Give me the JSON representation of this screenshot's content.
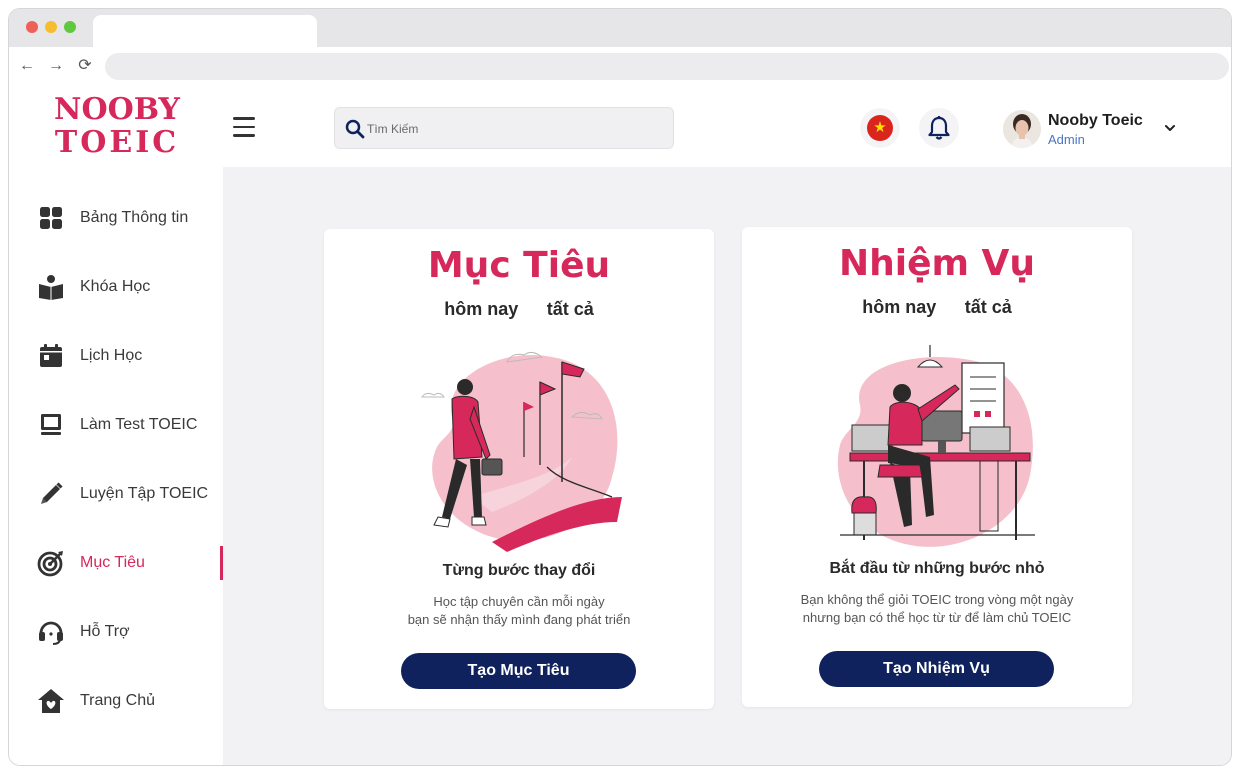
{
  "logo": {
    "line1": "NOOBY",
    "line2": "TOEIC"
  },
  "search": {
    "placeholder": "Tìm Kiếm"
  },
  "user": {
    "name": "Nooby Toeic",
    "role": "Admin"
  },
  "sidebar": {
    "items": [
      {
        "label": "Bảng Thông tin",
        "icon": "dashboard-icon"
      },
      {
        "label": "Khóa Học",
        "icon": "course-icon"
      },
      {
        "label": "Lịch Học",
        "icon": "calendar-icon"
      },
      {
        "label": "Làm Test TOEIC",
        "icon": "computer-icon"
      },
      {
        "label": "Luyện Tập TOEIC",
        "icon": "pencil-icon"
      },
      {
        "label": "Mục Tiêu",
        "icon": "target-icon",
        "active": true
      },
      {
        "label": "Hỗ Trợ",
        "icon": "headset-icon"
      },
      {
        "label": "Trang Chủ",
        "icon": "home-icon"
      }
    ]
  },
  "cards": [
    {
      "title": "Mục Tiêu",
      "filters": [
        "hôm nay",
        "tất cả"
      ],
      "subtitle": "Từng bước thay đổi",
      "desc_line1": "Học tập chuyên cần mỗi ngày",
      "desc_line2": "bạn sẽ nhận thấy mình đang phát triển",
      "button": "Tạo Mục Tiêu"
    },
    {
      "title": "Nhiệm Vụ",
      "filters": [
        "hôm nay",
        "tất cả"
      ],
      "subtitle": "Bắt đầu từ những bước nhỏ",
      "desc_line1": "Bạn không thể giỏi TOEIC trong vòng một ngày",
      "desc_line2": "nhưng bạn có thể học từ từ để làm chủ TOEIC",
      "button": "Tạo Nhiệm Vụ"
    }
  ],
  "colors": {
    "accent": "#d6285a",
    "navy": "#0f225e",
    "background": "#f2f2f4"
  }
}
